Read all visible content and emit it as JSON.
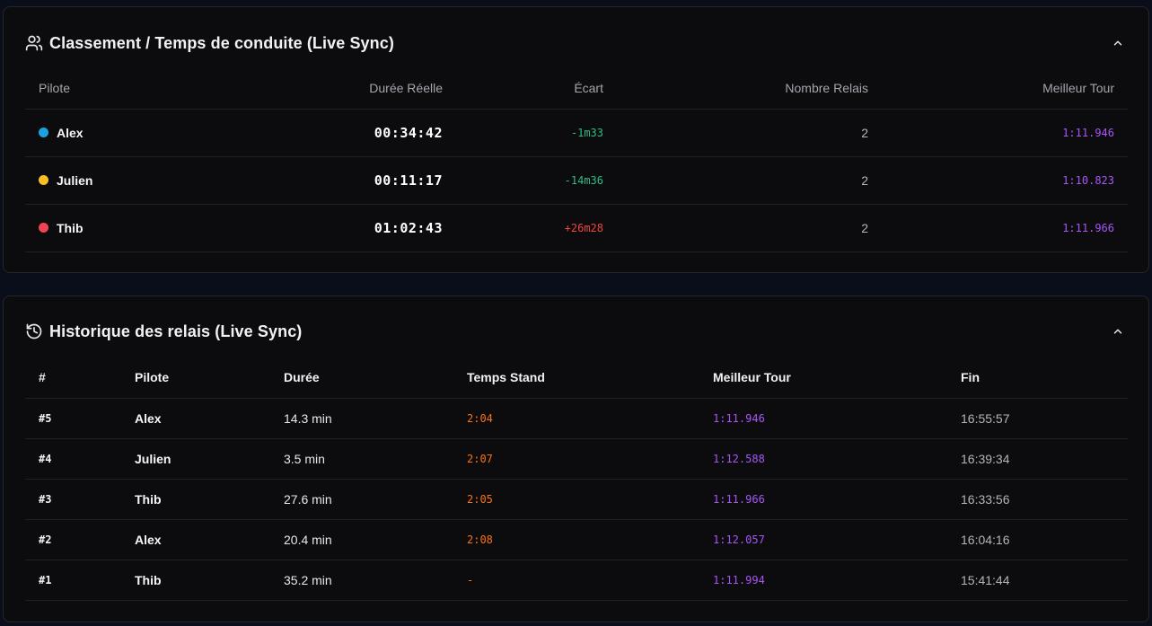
{
  "standings": {
    "title": "Classement / Temps de conduite (Live Sync)",
    "columns": [
      "Pilote",
      "Durée Réelle",
      "Écart",
      "Nombre Relais",
      "Meilleur Tour"
    ],
    "rows": [
      {
        "pilot": "Alex",
        "color": "#1aa3de",
        "duration": "00:34:42",
        "gap": "-1m33",
        "relays": "2",
        "best_lap": "1:11.946"
      },
      {
        "pilot": "Julien",
        "color": "#fbbf24",
        "duration": "00:11:17",
        "gap": "-14m36",
        "relays": "2",
        "best_lap": "1:10.823"
      },
      {
        "pilot": "Thib",
        "color": "#ef4454",
        "duration": "01:02:43",
        "gap": "+26m28",
        "relays": "2",
        "best_lap": "1:11.966"
      }
    ]
  },
  "history": {
    "title": "Historique des relais (Live Sync)",
    "columns": [
      "#",
      "Pilote",
      "Durée",
      "Temps Stand",
      "Meilleur Tour",
      "Fin"
    ],
    "rows": [
      {
        "num": "#5",
        "pilot": "Alex",
        "duration": "14.3 min",
        "stand": "2:04",
        "best_lap": "1:11.946",
        "end": "16:55:57"
      },
      {
        "num": "#4",
        "pilot": "Julien",
        "duration": "3.5 min",
        "stand": "2:07",
        "best_lap": "1:12.588",
        "end": "16:39:34"
      },
      {
        "num": "#3",
        "pilot": "Thib",
        "duration": "27.6 min",
        "stand": "2:05",
        "best_lap": "1:11.966",
        "end": "16:33:56"
      },
      {
        "num": "#2",
        "pilot": "Alex",
        "duration": "20.4 min",
        "stand": "2:08",
        "best_lap": "1:12.057",
        "end": "16:04:16"
      },
      {
        "num": "#1",
        "pilot": "Thib",
        "duration": "35.2 min",
        "stand": "-",
        "best_lap": "1:11.994",
        "end": "15:41:44"
      }
    ]
  },
  "icons": {
    "standings": "users-icon",
    "history": "history-icon",
    "collapse": "chevron-up-icon"
  },
  "colors": {
    "gap_negative": "#2dbd84",
    "gap_positive": "#ef4444",
    "best_lap": "#a855f7",
    "stand_time": "#f97316"
  }
}
